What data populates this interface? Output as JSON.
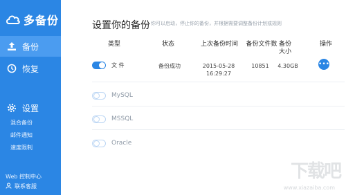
{
  "app": {
    "name": "多备份"
  },
  "sidebar": {
    "items": [
      {
        "label": "备份",
        "icon": "upload-icon",
        "active": true
      },
      {
        "label": "恢复",
        "icon": "history-icon",
        "active": false
      }
    ],
    "settings": {
      "label": "设置",
      "icon": "gear-icon",
      "subitems": [
        "混合备份",
        "邮件通知",
        "速度限制"
      ]
    },
    "footer": {
      "web_console": "Web 控制中心",
      "contact": "联系客服"
    }
  },
  "main": {
    "title": "设置你的备份",
    "subtitle": "你可以启动，停止你的备份，并根据需要调整备份计划或规则",
    "columns": [
      "类型",
      "状态",
      "上次备份时间",
      "备份文件数",
      "备份大小",
      "操作"
    ],
    "rows": [
      {
        "type": "文 件",
        "enabled": true,
        "status": "备份成功",
        "last_time": "2015-05-28",
        "last_clock": "16:29:27",
        "files": "10851",
        "size": "4.30GB",
        "action_icon": "more-dots-icon"
      },
      {
        "type": "MySQL",
        "enabled": false,
        "status": "",
        "last_time": "",
        "last_clock": "",
        "files": "",
        "size": ""
      },
      {
        "type": "MSSQL",
        "enabled": false,
        "status": "",
        "last_time": "",
        "last_clock": "",
        "files": "",
        "size": ""
      },
      {
        "type": "Oracle",
        "enabled": false,
        "status": "",
        "last_time": "",
        "last_clock": "",
        "files": "",
        "size": ""
      }
    ]
  },
  "watermark": {
    "big": "下载吧",
    "small": "www.xiazaiba.com"
  },
  "colors": {
    "sidebar": "#2b86e4",
    "sidebar_active": "#4b9cf0",
    "accent": "#2b86e4"
  }
}
